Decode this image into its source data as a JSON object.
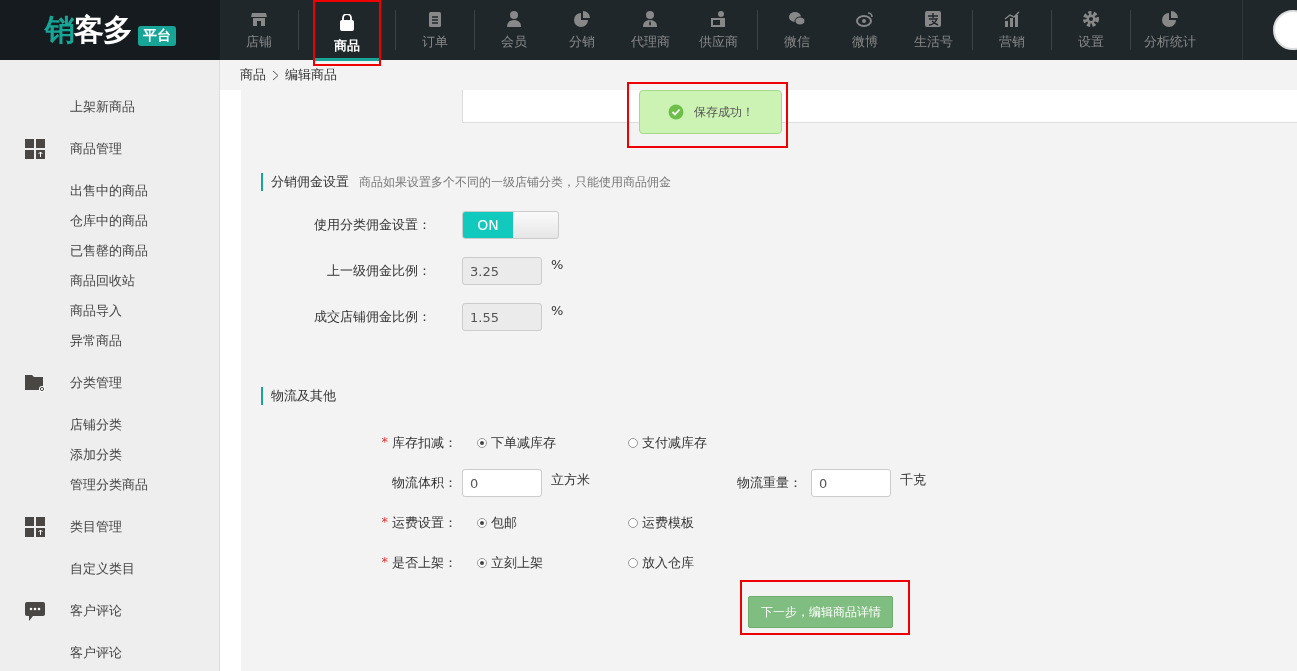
{
  "logo": {
    "name": "销客多",
    "badge": "平台"
  },
  "nav": {
    "groups": [
      [
        {
          "label": "店铺",
          "selected": false,
          "highlighted": false
        }
      ],
      [
        {
          "label": "商品",
          "selected": true,
          "highlighted": true
        }
      ],
      [
        {
          "label": "订单",
          "selected": false,
          "highlighted": false
        }
      ],
      [
        {
          "label": "会员",
          "selected": false,
          "highlighted": false
        },
        {
          "label": "分销",
          "selected": false,
          "highlighted": false
        },
        {
          "label": "代理商",
          "selected": false,
          "highlighted": false
        },
        {
          "label": "供应商",
          "selected": false,
          "highlighted": false
        }
      ],
      [
        {
          "label": "微信",
          "selected": false,
          "highlighted": false
        },
        {
          "label": "微博",
          "selected": false,
          "highlighted": false
        },
        {
          "label": "生活号",
          "selected": false,
          "highlighted": false
        }
      ],
      [
        {
          "label": "营销",
          "selected": false,
          "highlighted": false
        }
      ],
      [
        {
          "label": "设置",
          "selected": false,
          "highlighted": false
        }
      ],
      [
        {
          "label": "分析统计",
          "selected": false,
          "highlighted": false
        }
      ]
    ]
  },
  "sidebar": {
    "items": [
      {
        "kind": "link",
        "label": "上架新商品"
      },
      {
        "kind": "group",
        "label": "商品管理"
      },
      {
        "kind": "link",
        "label": "出售中的商品"
      },
      {
        "kind": "link",
        "label": "仓库中的商品"
      },
      {
        "kind": "link",
        "label": "已售罄的商品"
      },
      {
        "kind": "link",
        "label": "商品回收站"
      },
      {
        "kind": "link",
        "label": "商品导入"
      },
      {
        "kind": "link",
        "label": "异常商品"
      },
      {
        "kind": "group",
        "label": "分类管理"
      },
      {
        "kind": "link",
        "label": "店铺分类"
      },
      {
        "kind": "link",
        "label": "添加分类"
      },
      {
        "kind": "link",
        "label": "管理分类商品"
      },
      {
        "kind": "group",
        "label": "类目管理"
      },
      {
        "kind": "link",
        "label": "自定义类目"
      },
      {
        "kind": "group",
        "label": "客户评论"
      },
      {
        "kind": "link",
        "label": "客户评论"
      }
    ]
  },
  "breadcrumb": [
    "商品",
    "编辑商品"
  ],
  "toast": {
    "text": "保存成功！",
    "highlighted": true
  },
  "commission": {
    "title": "分销佣金设置",
    "note": "商品如果设置多个不同的一级店铺分类，只能使用商品佣金",
    "toggle": {
      "label": "使用分类佣金设置：",
      "on": true,
      "text": "ON"
    },
    "fields": [
      {
        "label": "上一级佣金比例：",
        "value": "3.25",
        "unit": "%"
      },
      {
        "label": "成交店铺佣金比例：",
        "value": "1.55",
        "unit": "%"
      }
    ]
  },
  "logistics": {
    "title": "物流及其他",
    "rows": [
      {
        "kind": "radio",
        "required_mark": "*",
        "label": "库存扣减：",
        "options": [
          {
            "label": "下单减库存",
            "selected": true
          },
          {
            "label": "支付减库存",
            "selected": false
          }
        ]
      },
      {
        "kind": "inputs",
        "fields": [
          {
            "label": "物流体积：",
            "value": "0",
            "unit": "立方米"
          },
          {
            "label": "物流重量：",
            "value": "0",
            "unit": "千克"
          }
        ]
      },
      {
        "kind": "radio",
        "required_mark": "*",
        "label": "运费设置：",
        "options": [
          {
            "label": "包邮",
            "selected": true
          },
          {
            "label": "运费模板",
            "selected": false
          }
        ]
      },
      {
        "kind": "radio",
        "required_mark": "*",
        "label": "是否上架：",
        "options": [
          {
            "label": "立刻上架",
            "selected": true
          },
          {
            "label": "放入仓库",
            "selected": false
          }
        ]
      }
    ]
  },
  "next_button": {
    "label": "下一步，编辑商品详情",
    "highlighted": true
  }
}
